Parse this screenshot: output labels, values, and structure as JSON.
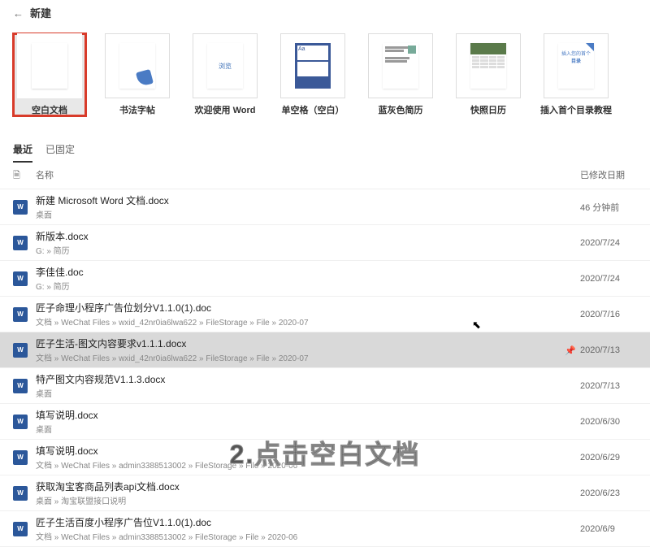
{
  "header": {
    "title": "新建"
  },
  "templates": [
    {
      "id": "blank",
      "label": "空白文档",
      "selected": true
    },
    {
      "id": "calli",
      "label": "书法字帖",
      "selected": false
    },
    {
      "id": "welcome",
      "label": "欢迎使用 Word",
      "welcome_text": "浏览",
      "selected": false
    },
    {
      "id": "spacing",
      "label": "单空格（空白）",
      "spacing_text": "Aa",
      "selected": false
    },
    {
      "id": "resume",
      "label": "蓝灰色简历",
      "selected": false
    },
    {
      "id": "calendar",
      "label": "快照日历",
      "selected": false
    },
    {
      "id": "toc",
      "label": "插入首个目录教程",
      "toc_line1": "插入您的首个",
      "toc_line2": "目录",
      "selected": false
    }
  ],
  "tabs": {
    "recent": "最近",
    "pinned": "已固定"
  },
  "list_headers": {
    "name": "名称",
    "modified": "已修改日期"
  },
  "files": [
    {
      "name": "新建 Microsoft Word 文档.docx",
      "path": "桌面",
      "date": "46 分钟前",
      "hovered": false,
      "pinned": false
    },
    {
      "name": "新版本.docx",
      "path": "G: » 简历",
      "date": "2020/7/24",
      "hovered": false,
      "pinned": false
    },
    {
      "name": "李佳佳.doc",
      "path": "G: » 简历",
      "date": "2020/7/24",
      "hovered": false,
      "pinned": false
    },
    {
      "name": "匠子命理小程序广告位划分V1.1.0(1).doc",
      "path": "文档 » WeChat Files » wxid_42nr0ia6lwa622 » FileStorage » File » 2020-07",
      "date": "2020/7/16",
      "hovered": false,
      "pinned": false
    },
    {
      "name": "匠子生活-图文内容要求v1.1.1.docx",
      "path": "文档 » WeChat Files » wxid_42nr0ia6lwa622 » FileStorage » File » 2020-07",
      "date": "2020/7/13",
      "hovered": true,
      "pinned": true
    },
    {
      "name": "特产图文内容规范V1.1.3.docx",
      "path": "桌面",
      "date": "2020/7/13",
      "hovered": false,
      "pinned": false
    },
    {
      "name": "填写说明.docx",
      "path": "桌面",
      "date": "2020/6/30",
      "hovered": false,
      "pinned": false
    },
    {
      "name": "填写说明.docx",
      "path": "文档 » WeChat Files » admin3388513002 » FileStorage » File » 2020-06",
      "date": "2020/6/29",
      "hovered": false,
      "pinned": false
    },
    {
      "name": "获取淘宝客商品列表api文档.docx",
      "path": "桌面 » 淘宝联盟接口说明",
      "date": "2020/6/23",
      "hovered": false,
      "pinned": false
    },
    {
      "name": "匠子生活百度小程序广告位V1.1.0(1).doc",
      "path": "文档 » WeChat Files » admin3388513002 » FileStorage » File » 2020-06",
      "date": "2020/6/9",
      "hovered": false,
      "pinned": false
    }
  ],
  "overlay": {
    "text": "2.点击空白文档"
  }
}
